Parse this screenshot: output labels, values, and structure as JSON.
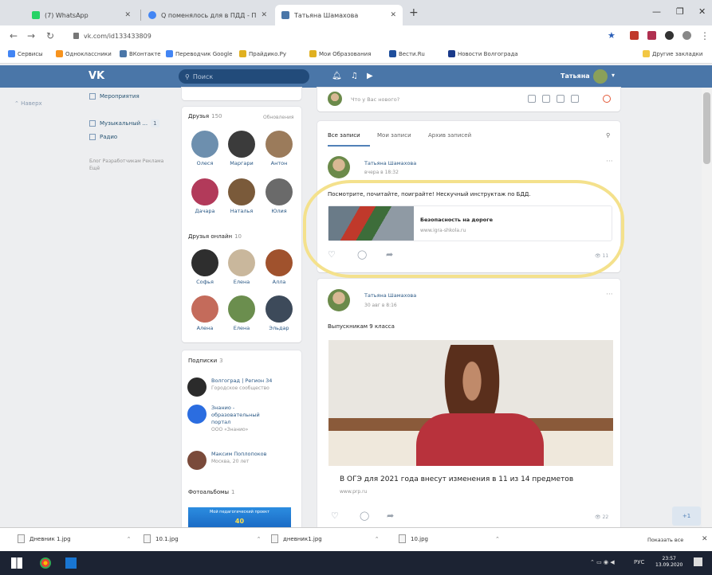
{
  "browser": {
    "tabs": [
      {
        "title": "(7) WhatsApp",
        "color": "#25d366"
      },
      {
        "title": "Q поменялось для в ПДД - П...",
        "color": "#4285f4"
      },
      {
        "title": "Татьяна Шамахова",
        "color": "#4a76a8"
      }
    ],
    "url": "vk.com/id133433809",
    "bookmarks": [
      "Сервисы",
      "Одноклассники",
      "ВКонтакте",
      "Переводчик Google",
      "Прайдико.Ру",
      "Мои Образования",
      "Вести.Ru",
      "Новости Волгограда",
      "Другие закладки"
    ]
  },
  "vk": {
    "logo": "VK",
    "search_placeholder": "Поиск",
    "user_name": "Татьяна",
    "accent": "#4a76a8"
  },
  "left": {
    "back_up": "Наверх",
    "nav": [
      {
        "label": "Мероприятия"
      },
      {
        "label": "Музыкальный ...",
        "badge": "1"
      },
      {
        "label": "Радио"
      }
    ],
    "footer": "Блог  Разработчикам  Реклама  Ещё"
  },
  "friends": {
    "title": "Друзья",
    "count": "150",
    "link": "Обновления",
    "list": [
      {
        "name": "Олеся",
        "color": "#6d8fae"
      },
      {
        "name": "Маргари",
        "color": "#3b3b3b"
      },
      {
        "name": "Антон",
        "color": "#9b7b5b"
      },
      {
        "name": "Дачара",
        "color": "#b23a5a"
      },
      {
        "name": "Наталья",
        "color": "#7a5a3a"
      },
      {
        "name": "Юлия",
        "color": "#6a6a6a"
      }
    ]
  },
  "online": {
    "title": "Друзья онлайн",
    "count": "10",
    "list": [
      {
        "name": "Софья",
        "color": "#2e2e2e"
      },
      {
        "name": "Елена",
        "color": "#c9b79c"
      },
      {
        "name": "Алла",
        "color": "#a0522d"
      },
      {
        "name": "Алена",
        "color": "#c46b5b"
      },
      {
        "name": "Елена",
        "color": "#6b8e4e"
      },
      {
        "name": "Эльдар",
        "color": "#3d4a5a"
      }
    ]
  },
  "subscriptions": {
    "title": "Подписки",
    "count": "3",
    "list": [
      {
        "name": "Волгоград | Регион 34",
        "meta": "Городское сообщество",
        "color": "#2b2b2b"
      },
      {
        "name": "Знанио - образовательный портал",
        "meta": "ООО «Знанио»",
        "color": "#2b6de0"
      },
      {
        "name": "Максим Поплопоков",
        "meta": "Москва, 20 лет",
        "color": "#7a4a3a"
      }
    ]
  },
  "albums": {
    "title": "Фотоальбомы",
    "count": "1",
    "thumb_label": "Мой педагогический проект",
    "thumb_number": "40"
  },
  "composer": {
    "placeholder": "Что у Вас нового?"
  },
  "feed_tabs": [
    "Все записи",
    "Мои записи",
    "Архив записей"
  ],
  "post1": {
    "author": "Татьяна Шамахова",
    "date": "вчера в 18:32",
    "text": "Посмотрите, почитайте, поиграйте! Нескучный инструктаж по БДД.",
    "link_title": "Безопасность на дороге",
    "link_url": "www.igra-shkola.ru",
    "views": "11"
  },
  "post2": {
    "author": "Татьяна Шамахова",
    "date": "30 авг в 8:16",
    "text": "Выпускникам 9 класса",
    "news_title": "В ОГЭ для 2021 года внесут изменения в 11 из 14 предметов",
    "news_site": "www.prp.ru",
    "views": "22"
  },
  "downloads": [
    {
      "name": "Дневник 1.jpg"
    },
    {
      "name": "10.1.jpg"
    },
    {
      "name": "дневник1.jpg"
    },
    {
      "name": "10.jpg"
    }
  ],
  "downloads_show_all": "Показать все",
  "mini_chat": "+1",
  "taskbar": {
    "lang": "РУС",
    "time": "23:57",
    "date": "13.09.2020"
  }
}
